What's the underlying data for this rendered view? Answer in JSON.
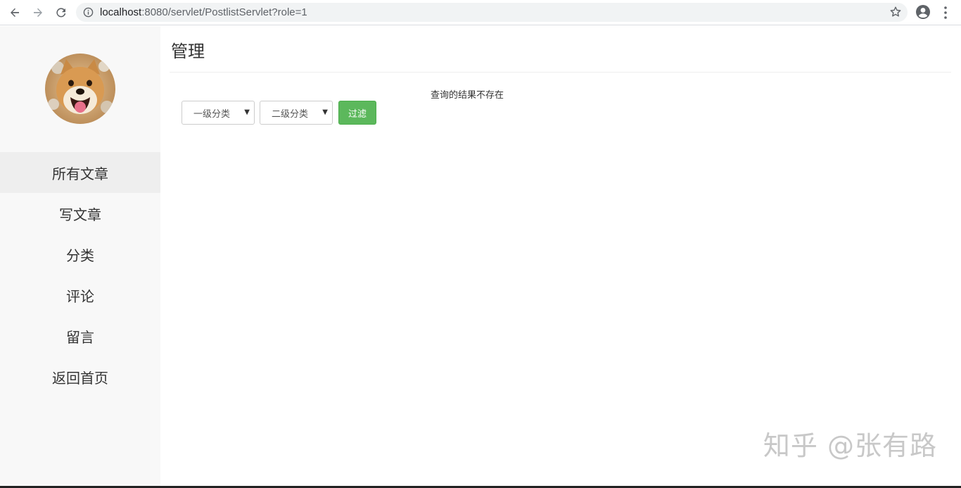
{
  "browser": {
    "url_host": "localhost",
    "url_rest": ":8080/servlet/PostlistServlet?role=1",
    "icons": {
      "back": "arrow-left-icon",
      "forward": "arrow-right-icon",
      "reload": "reload-icon",
      "info": "info-icon",
      "bookmark": "star-icon",
      "profile": "account-circle-icon",
      "menu": "kebab-menu-icon"
    }
  },
  "sidebar": {
    "avatar_alt": "dog-avatar",
    "items": [
      {
        "label": "所有文章",
        "active": true
      },
      {
        "label": "写文章",
        "active": false
      },
      {
        "label": "分类",
        "active": false
      },
      {
        "label": "评论",
        "active": false
      },
      {
        "label": "留言",
        "active": false
      },
      {
        "label": "返回首页",
        "active": false
      }
    ]
  },
  "main": {
    "title": "管理",
    "result_message": "查询的结果不存在",
    "filters": {
      "level1": "一级分类",
      "level2": "二级分类",
      "button": "过滤"
    }
  },
  "watermark": "知乎 @张有路",
  "colors": {
    "accent_green": "#5cb85c",
    "sidebar_bg": "#f8f8f8",
    "active_item_bg": "#eeeeee"
  }
}
